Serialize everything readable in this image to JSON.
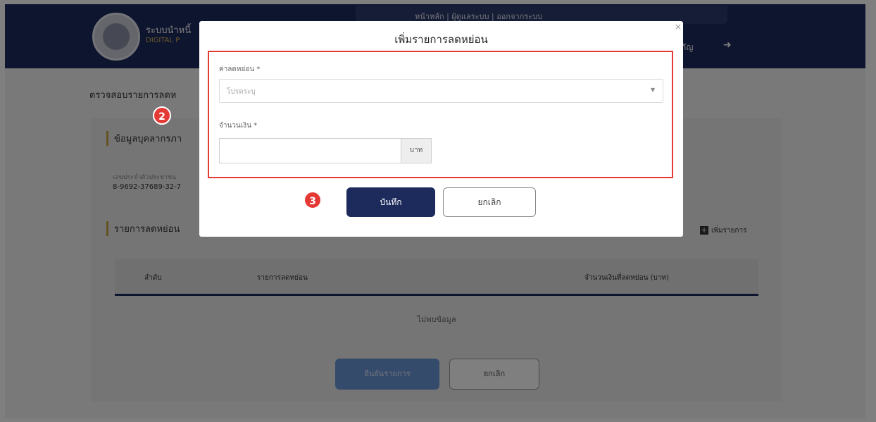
{
  "header": {
    "system_title": "ระบบนำหนี้",
    "system_subtitle": "DIGITAL P",
    "top_nav_text": "หน้าหลัก | ผู้ดูแลระบบ | ออกจากระบบ",
    "user_text": "กัญ"
  },
  "page": {
    "title": "ตรวจสอบรายการลดห",
    "section1_title": "ข้อมูลบุคลากรภา",
    "citizen_id_label": "เลขประจำตัวประชาชน",
    "citizen_id_value": "8-9692-37689-32-7",
    "section2_title": "รายการลดหย่อน",
    "add_item_label": "เพิ่มรายการ",
    "table": {
      "columns": [
        "ลำดับ",
        "รายการลดหย่อน",
        "จำนวนเงินที่ลดหย่อน (บาท)"
      ],
      "empty_text": "ไม่พบข้อมูล"
    },
    "confirm_button": "ยืนยันรายการ",
    "cancel_button": "ยกเลิก"
  },
  "modal": {
    "title": "เพิ่มรายการลดหย่อน",
    "close_symbol": "×",
    "field1_label": "ค่าลดหย่อน *",
    "field1_placeholder": "โปรดระบุ",
    "field2_label": "จำนวนเงิน *",
    "field2_value": "",
    "field2_addon": "บาท",
    "save_button": "บันทึก",
    "cancel_button": "ยกเลิก"
  },
  "annotations": {
    "step2": "2",
    "step3": "3"
  },
  "colors": {
    "header_navy": "#1d2b5c",
    "accent_gold": "#c9a542",
    "highlight_red": "#e53935",
    "disabled_blue": "#6a96d8"
  }
}
